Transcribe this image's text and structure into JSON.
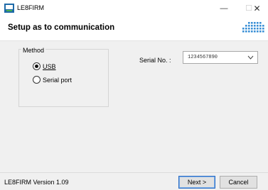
{
  "window": {
    "title": "LE8FIRM",
    "minimize_glyph": "—",
    "maximize_glyph": "☐",
    "close_glyph": "✕"
  },
  "header": {
    "title": "Setup as to communication"
  },
  "method": {
    "legend": "Method",
    "options": [
      {
        "label": "USB",
        "checked": true
      },
      {
        "label": "Serial port",
        "checked": false
      }
    ]
  },
  "serial": {
    "label": "Serial No. :",
    "value": "1234567890"
  },
  "footer": {
    "version": "LE8FIRM Version 1.09",
    "next_label": "Next >",
    "cancel_label": "Cancel"
  },
  "colors": {
    "accent": "#2b6cc4",
    "logo": "#3a8fd6"
  }
}
